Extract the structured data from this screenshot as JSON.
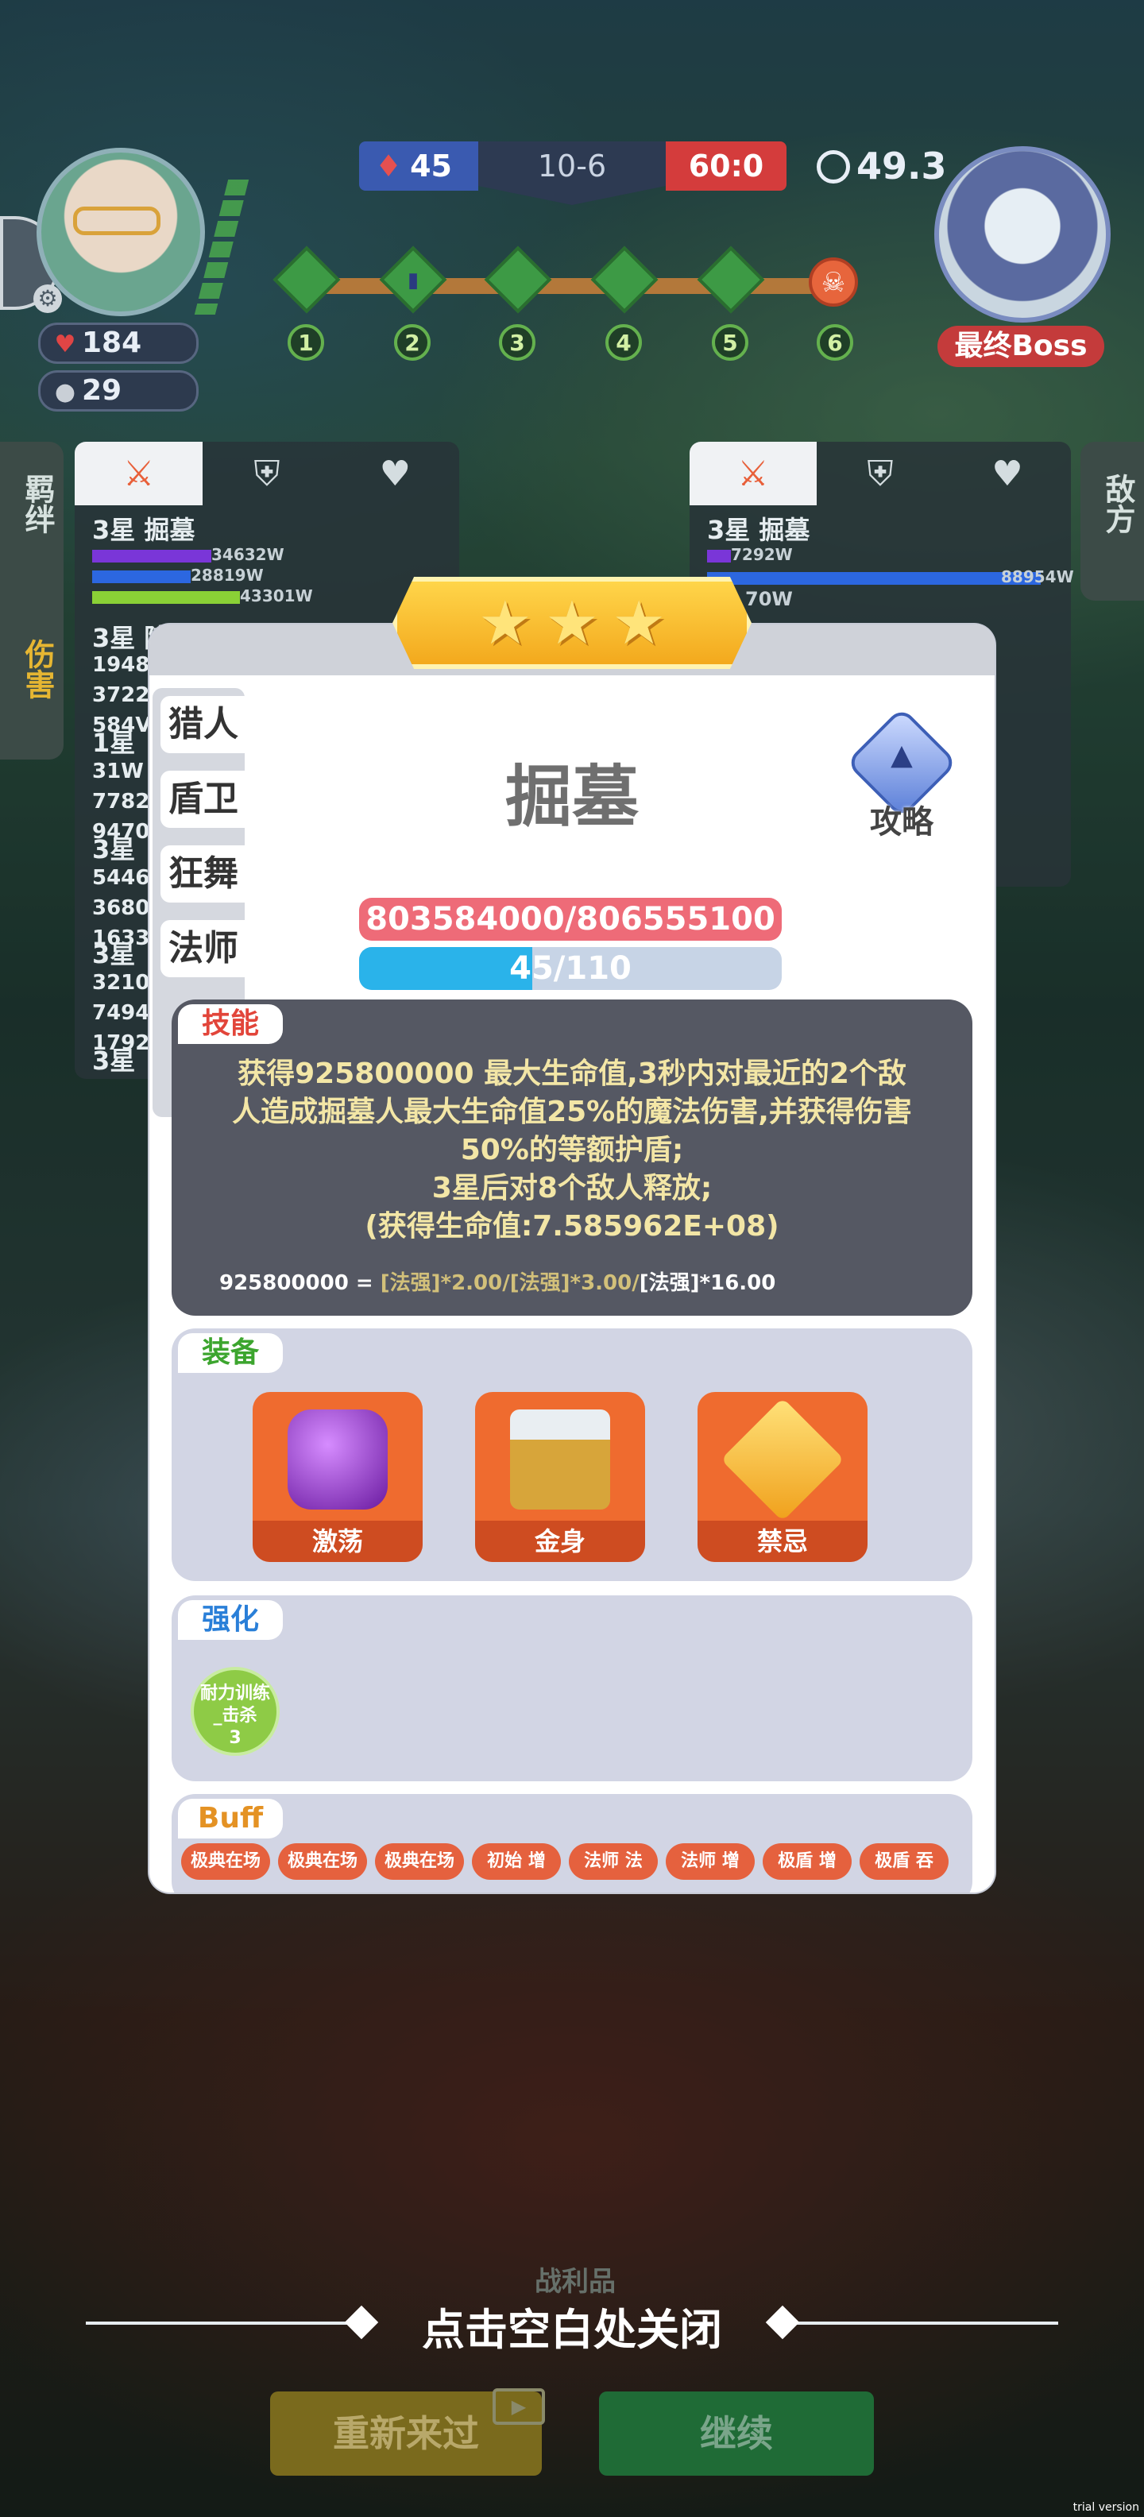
{
  "hud": {
    "hp": "184",
    "coins": "29",
    "score_left": "45",
    "level": "10-6",
    "score_right": "60:0",
    "timer": "49.3",
    "stages": [
      "1",
      "2",
      "3",
      "4",
      "5",
      "6"
    ],
    "boss_label": "最终Boss"
  },
  "side_tabs_left": [
    "羁绊",
    "伤害"
  ],
  "side_tabs_right": [
    "敌方"
  ],
  "damage_left": {
    "tabs": [
      "sword-icon",
      "shield-icon",
      "heart-icon"
    ],
    "row1_name": "3星 掘墓",
    "bars": [
      {
        "label": "34632W",
        "color": "#7a36d8",
        "pct": 0.55
      },
      {
        "label": "28819W",
        "color": "#2c67e0",
        "pct": 0.46
      },
      {
        "label": "43301W",
        "color": "#8ad136",
        "pct": 0.69
      }
    ],
    "row_names": [
      "3星 陪",
      "1星",
      "3星",
      "3星",
      "3星"
    ],
    "nums": [
      "1948",
      "3722",
      "584V",
      "31W",
      "7782",
      "9470",
      "5446",
      "3680",
      "1633",
      "3210",
      "7494",
      "1792"
    ]
  },
  "damage_right": {
    "row1_name": "3星 掘墓",
    "bars": [
      {
        "label": "7292W",
        "color": "#7a36d8",
        "pct": 0.08
      },
      {
        "label": "88954W",
        "color": "#2c67e0",
        "pct": 1.0
      }
    ],
    "row2_partial": "70W"
  },
  "modal": {
    "stars": 3,
    "class_tabs": [
      "猎人",
      "盾卫",
      "狂舞",
      "法师"
    ],
    "hero_name": "掘墓",
    "guide_label": "攻略",
    "hp_text": "803584000/806555100",
    "hp_current": 803584000,
    "hp_max": 806555100,
    "mp_text": "45/110",
    "mp_fraction": 0.409,
    "skill_label": "技能",
    "skill_lines": [
      "获得925800000 最大生命值,3秒内对最近的2个敌",
      "人造成掘墓人最大生命值25%的魔法伤害,并获得伤害",
      "50%的等额护盾;",
      "3星后对8个敌人释放;",
      "(获得生命值:7.585962E+08)"
    ],
    "formula_value": "925800000 =",
    "formula_rest": "[法强]*2.00/[法强]*3.00/",
    "formula_end": "[法强]*16.00",
    "equip_label": "装备",
    "equipment": [
      {
        "name": "激荡",
        "color": "#8a2fc4"
      },
      {
        "name": "金身",
        "color": "#c9a23a"
      },
      {
        "name": "禁忌",
        "color": "#f5b31d"
      }
    ],
    "boost_label": "强化",
    "boost_item": [
      "耐力训练",
      "_击杀",
      "3"
    ],
    "buff_label": "Buff",
    "buffs": [
      "极典在场",
      "极典在场",
      "极典在场",
      "初始 增",
      "法师 法",
      "法师 增",
      "极盾 增",
      "极盾 吞"
    ]
  },
  "bottom": {
    "battle_tag": "战利品",
    "close_hint": "点击空白处关闭",
    "retry": "重新来过",
    "continue": "继续",
    "trial": "trial version"
  }
}
